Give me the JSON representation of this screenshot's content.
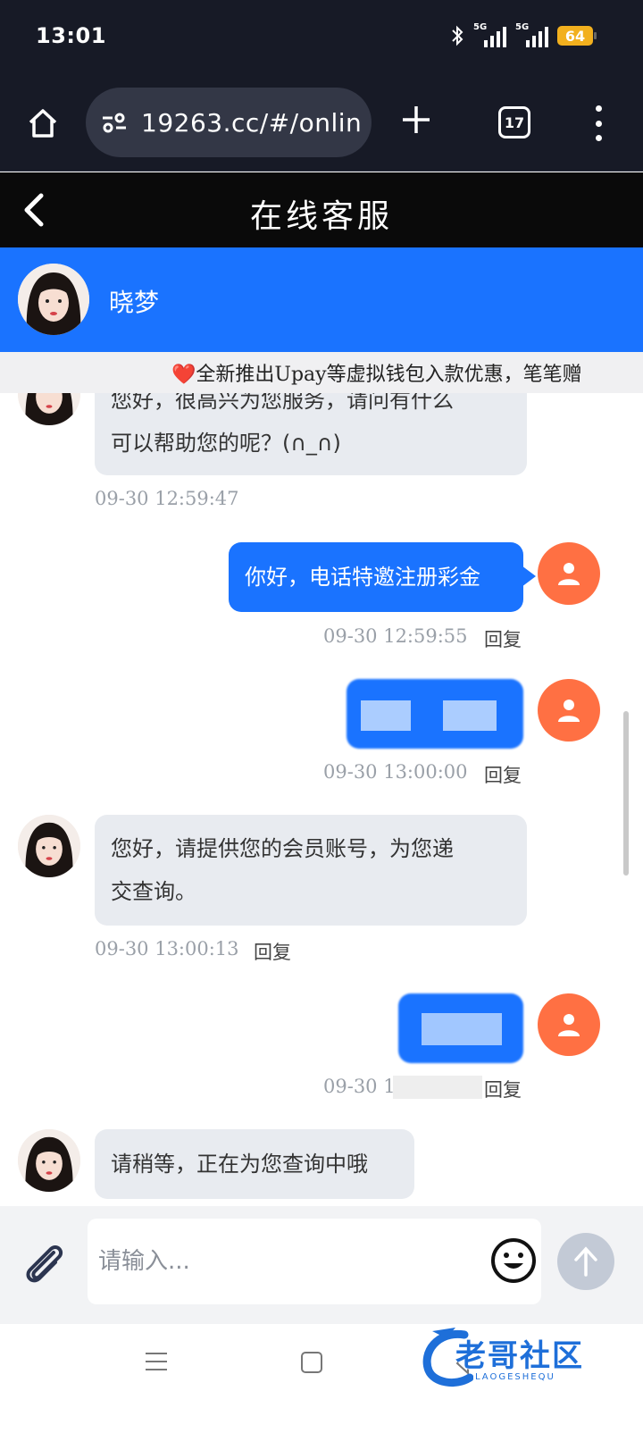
{
  "status_bar": {
    "time": "13:01",
    "network_1": "5G",
    "network_2": "5G",
    "battery": "64"
  },
  "browser": {
    "url": "19263.cc/#/onlin",
    "tab_count": "17"
  },
  "page": {
    "title": "在线客服"
  },
  "agent": {
    "name": "晓梦"
  },
  "marquee": {
    "heart": "❤️",
    "text": "全新推出Upay等虚拟钱包入款优惠，笔笔赠"
  },
  "messages": [
    {
      "from": "agent",
      "line1": "您好，很高兴为您服务，请问有什么",
      "line2": "可以帮助您的呢？(∩_∩)",
      "time": "09-30 12:59:47"
    },
    {
      "from": "user",
      "text": "你好，电话特邀注册彩金",
      "time": "09-30 12:59:55",
      "reply": "回复"
    },
    {
      "from": "user",
      "text": "",
      "time": "09-30 13:00:00",
      "reply": "回复"
    },
    {
      "from": "agent",
      "line1": "您好，请提供您的会员账号，为您递",
      "line2": "交查询。",
      "time": "09-30 13:00:13",
      "reply": "回复"
    },
    {
      "from": "user",
      "text": "",
      "time": "09-30 1",
      "reply": "回复"
    },
    {
      "from": "agent",
      "line1": "请稍等，正在为您查询中哦",
      "line2": ""
    }
  ],
  "input": {
    "placeholder": "请输入..."
  },
  "icons": {
    "home": "home-icon",
    "site_settings": "tune-icon",
    "new_tab": "plus-icon",
    "tabs": "tabs-icon",
    "menu": "more-vertical-icon",
    "back": "chevron-left-icon",
    "attach": "paperclip-icon",
    "emoji": "smiley-icon",
    "send": "arrow-up-icon",
    "user": "person-icon"
  },
  "colors": {
    "status_bg": "#171a26",
    "agent_header": "#1a73ff",
    "user_bubble": "#1a73ff",
    "agent_bubble": "#e8ebf0",
    "user_avatar": "#ff7043",
    "battery": "#f2b01e"
  },
  "watermark": {
    "title": "老哥社区",
    "subtitle": "LAOGESHEQU"
  }
}
